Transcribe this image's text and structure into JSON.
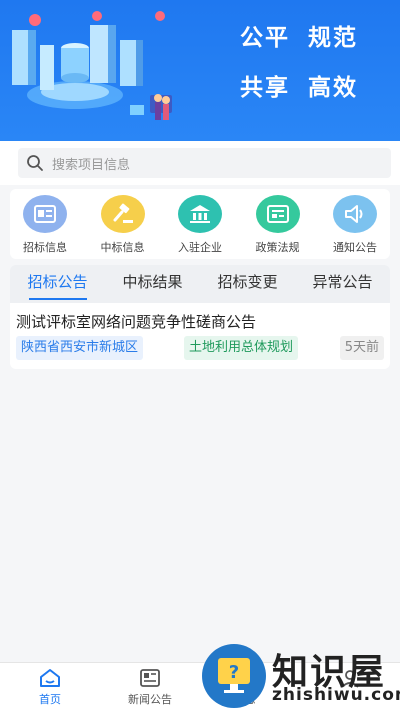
{
  "banner": {
    "slogan_line1_a": "公平",
    "slogan_line1_b": "规范",
    "slogan_line2_a": "共享",
    "slogan_line2_b": "高效"
  },
  "search": {
    "placeholder": "搜索项目信息",
    "icon": "search-icon"
  },
  "menu": [
    {
      "label": "招标信息",
      "icon": "document-icon",
      "color": "#8fb2ee"
    },
    {
      "label": "中标信息",
      "icon": "gavel-icon",
      "color": "#f6cf4b"
    },
    {
      "label": "入驻企业",
      "icon": "building-icon",
      "color": "#2ec1b0"
    },
    {
      "label": "政策法规",
      "icon": "newspaper-icon",
      "color": "#35c99d"
    },
    {
      "label": "通知公告",
      "icon": "speaker-icon",
      "color": "#7cc2ef"
    }
  ],
  "tabs": [
    "招标公告",
    "中标结果",
    "招标变更",
    "异常公告"
  ],
  "active_tab": "招标公告",
  "list": [
    {
      "title": "测试评标室网络问题竞争性磋商公告",
      "location": "陕西省西安市新城区",
      "category": "土地利用总体规划",
      "time": "5天前"
    }
  ],
  "bottom_nav": [
    {
      "label": "首页",
      "icon": "home-icon"
    },
    {
      "label": "新闻公告",
      "icon": "news-icon"
    },
    {
      "label": "息",
      "icon": "info-icon"
    },
    {
      "label": "",
      "icon": "user-icon"
    }
  ],
  "watermark": {
    "text": "知识屋",
    "sub": "zhishiwu.com",
    "mark": "®"
  },
  "colors": {
    "primary": "#1e78f0",
    "banner": "#2a86f6"
  }
}
